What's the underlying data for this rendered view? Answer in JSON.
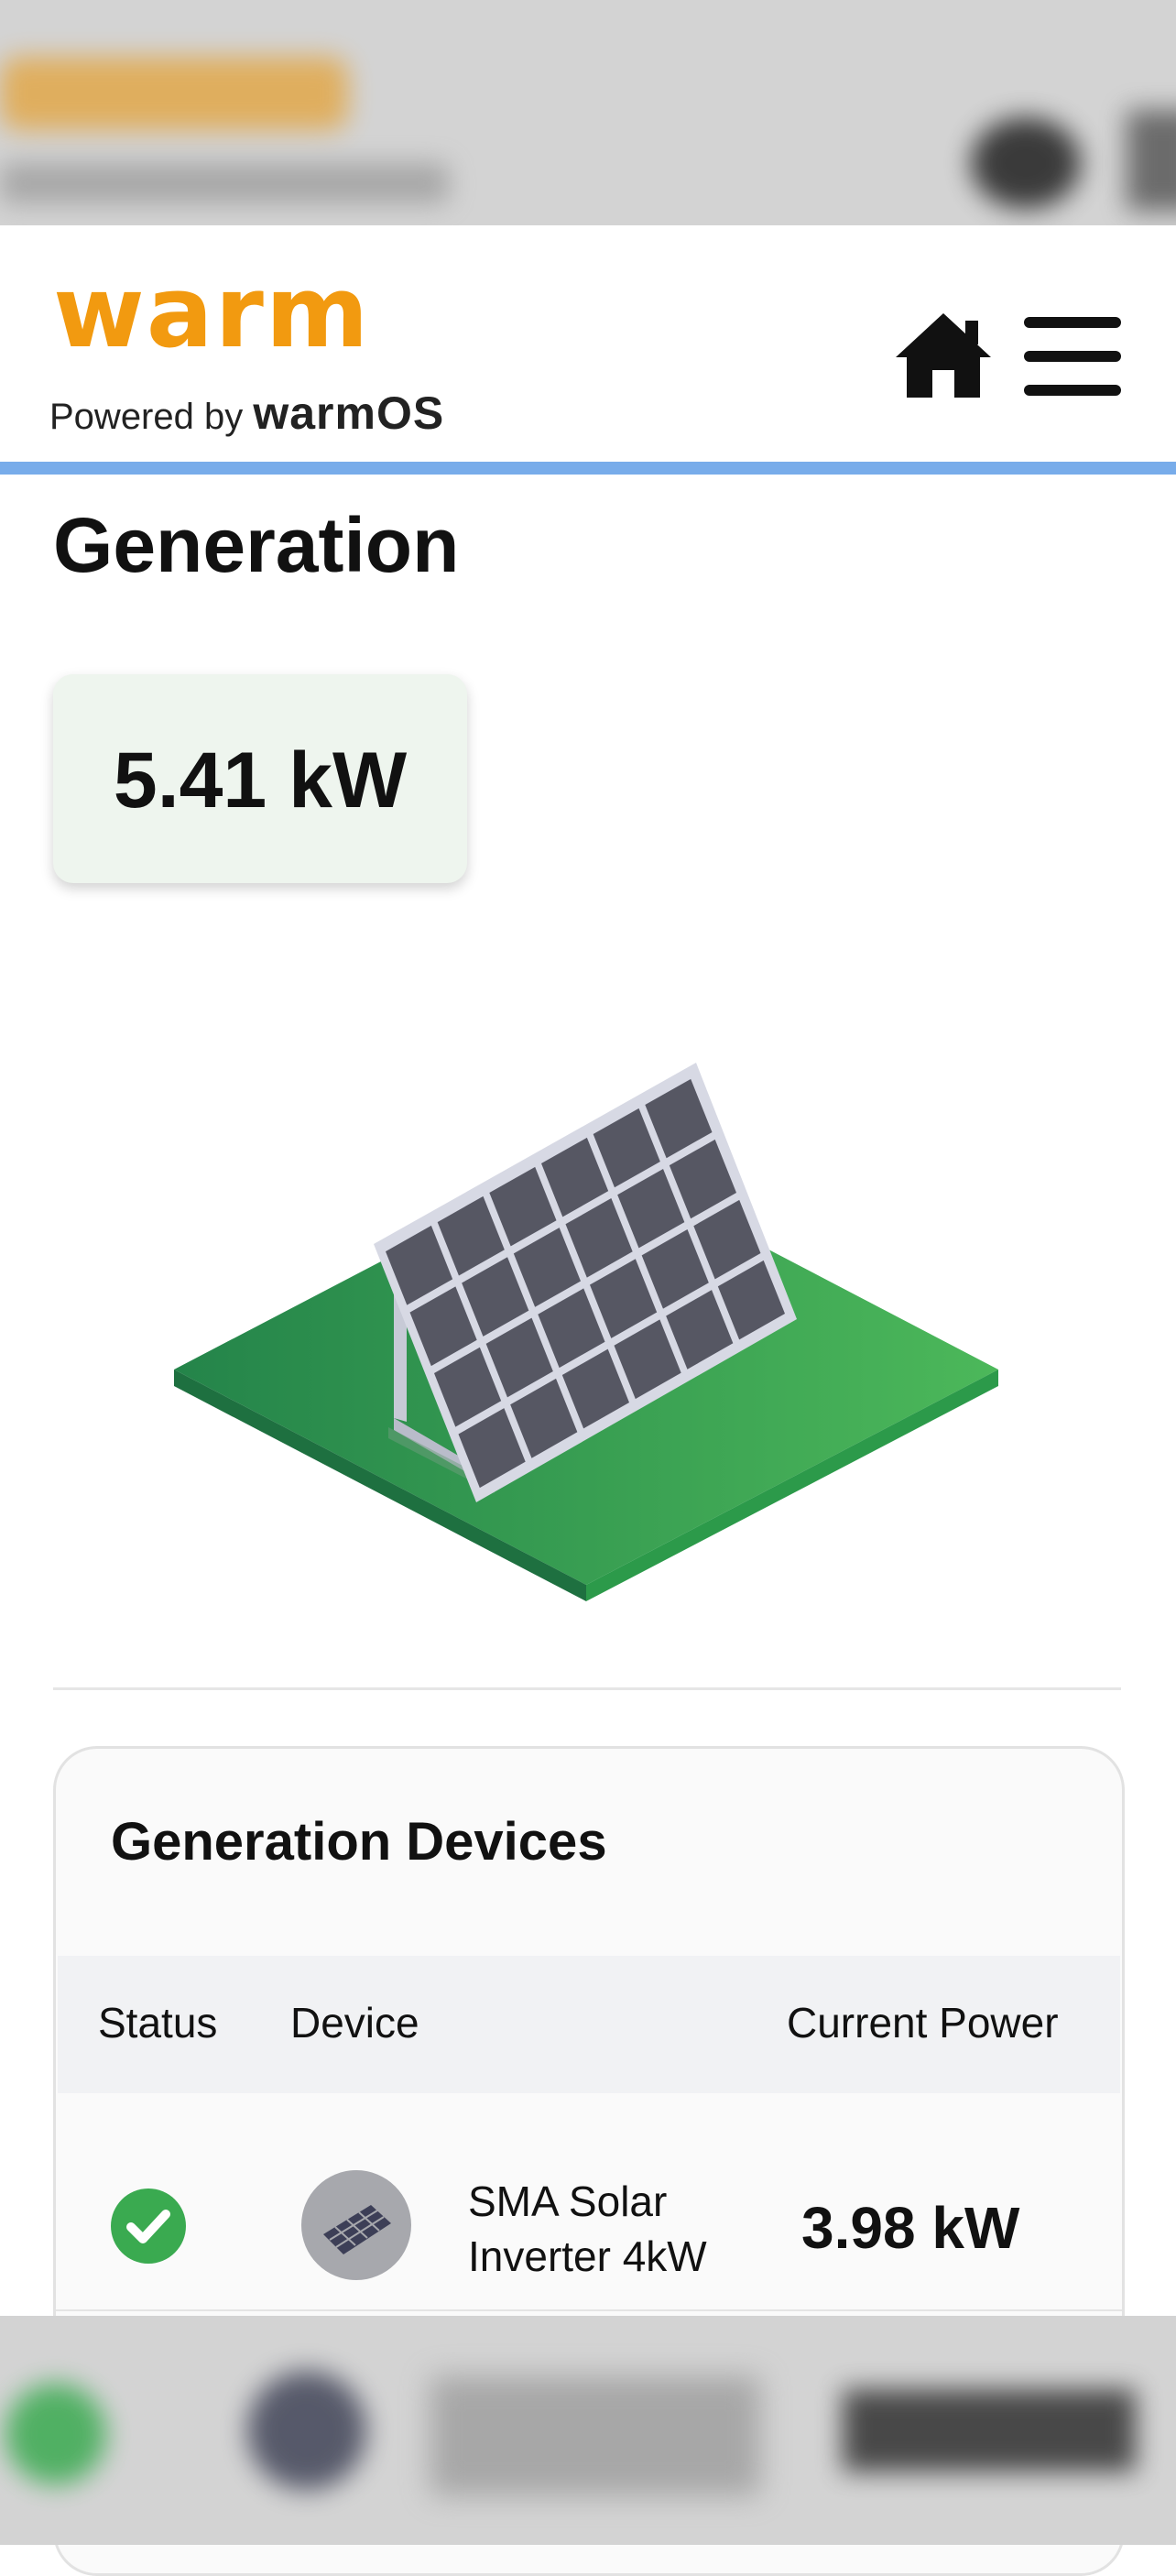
{
  "header": {
    "logo_text": "warm",
    "tagline_prefix": "Powered by ",
    "tagline_brand": "warmOS",
    "home_icon": "home-icon",
    "menu_icon": "hamburger-menu-icon",
    "accent_color": "#78acea",
    "brand_color": "#f29a10"
  },
  "page": {
    "title": "Generation",
    "current_generation": "5.41 kW"
  },
  "illustration": {
    "icon": "solar-panel-on-grass-illustration"
  },
  "devices": {
    "title": "Generation Devices",
    "columns": [
      "Status",
      "Device",
      "Current Power"
    ],
    "rows": [
      {
        "status_icon": "check-circle-icon",
        "status_color": "#3aaa50",
        "device_icon": "solar-panel-icon",
        "device_name_line1": "SMA Solar",
        "device_name_line2": "Inverter 4kW",
        "current_power": "3.98 kW"
      }
    ]
  }
}
